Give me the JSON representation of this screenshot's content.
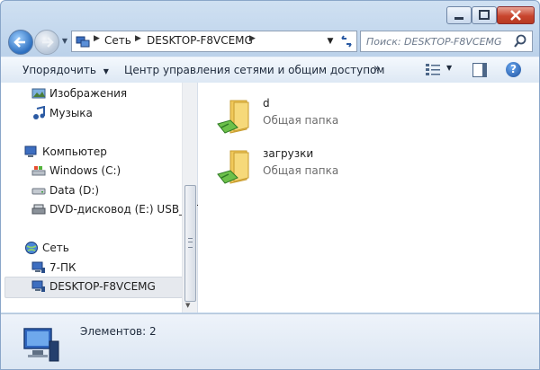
{
  "address": {
    "crumbs": [
      "Сеть",
      "DESKTOP-F8VCEMG"
    ]
  },
  "search": {
    "placeholder": "Поиск: DESKTOP-F8VCEMG"
  },
  "toolbar": {
    "organize": "Упорядочить",
    "network_center": "Центр управления сетями и общим доступом",
    "more": "»"
  },
  "nav": {
    "items": [
      {
        "label": "Изображения",
        "icon": "pictures-icon"
      },
      {
        "label": "Музыка",
        "icon": "music-icon"
      },
      {
        "label": "Компьютер",
        "icon": "computer-icon"
      },
      {
        "label": "Windows (C:)",
        "icon": "windows-drive-icon"
      },
      {
        "label": "Data (D:)",
        "icon": "drive-icon"
      },
      {
        "label": "DVD-дисковод (E:) USB_STF",
        "icon": "dvd-drive-icon"
      },
      {
        "label": "Сеть",
        "icon": "network-icon"
      },
      {
        "label": "7-ПК",
        "icon": "network-computer-icon"
      },
      {
        "label": "DESKTOP-F8VCEMG",
        "icon": "network-computer-icon",
        "selected": true
      }
    ]
  },
  "content": {
    "folders": [
      {
        "name": "d",
        "desc": "Общая папка"
      },
      {
        "name": "загрузки",
        "desc": "Общая папка"
      }
    ]
  },
  "status": {
    "text": "Элементов: 2"
  }
}
